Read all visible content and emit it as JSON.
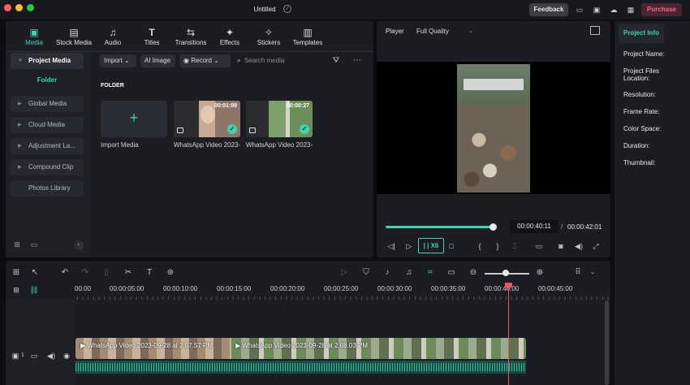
{
  "window": {
    "title": "Untitled",
    "feedback_label": "Feedback",
    "purchase_label": "Purchase",
    "traffic_colors": [
      "#fe5f57",
      "#febc2e",
      "#28c840"
    ]
  },
  "media_tabs": [
    {
      "label": "Media",
      "icon": "media-icon",
      "active": true
    },
    {
      "label": "Stock Media",
      "icon": "stock-media-icon"
    },
    {
      "label": "Audio",
      "icon": "music-note-icon"
    },
    {
      "label": "Titles",
      "icon": "text-t-icon"
    },
    {
      "label": "Transitions",
      "icon": "transitions-icon"
    },
    {
      "label": "Effects",
      "icon": "effects-sparkle-icon"
    },
    {
      "label": "Stickers",
      "icon": "stickers-icon"
    },
    {
      "label": "Templates",
      "icon": "templates-icon"
    }
  ],
  "sidebar": {
    "project_media": "Project Media",
    "folder": "Folder",
    "items": [
      "Global Media",
      "Cloud Media",
      "Adjustment La...",
      "Compound Clip",
      "Photos Library"
    ]
  },
  "media_toolbar": {
    "import": "Import",
    "ai_image": "AI Image",
    "record": "Record",
    "search_placeholder": "Search media"
  },
  "media_area": {
    "folder_heading": "FOLDER",
    "import_label": "Import Media",
    "clips": [
      {
        "label": "WhatsApp Video 2023-...",
        "duration": "00:01:09"
      },
      {
        "label": "WhatsApp Video 2023-...",
        "duration": "00:00:27"
      }
    ]
  },
  "player": {
    "label": "Player",
    "quality": "Full Quality",
    "current_time": "00:00:40:11",
    "separator": "/",
    "total_time": "00:00:42:01",
    "speed_label": "X6",
    "progress_percent": 0.96
  },
  "project_info": {
    "tab": "Project Info",
    "rows": [
      "Project Name:",
      "Project Files Location:",
      "Resolution:",
      "Frame Rate:",
      "Color Space:",
      "Duration:",
      "Thumbnail:"
    ]
  },
  "timeline": {
    "ruler_labels": [
      "00:00",
      "00:00:05:00",
      "00:00:10:00",
      "00:00:15:00",
      "00:00:20:00",
      "00:00:25:00",
      "00:00:30:00",
      "00:00:35:00",
      "00:00:40:00",
      "00:00:45:00"
    ],
    "clip1_title": "WhatsApp Video 2023-09-28 at 2.07.57 PM",
    "clip2_title": "WhatsApp Video 2023-09-28 at 2.08.03 PM",
    "track_number": "1",
    "accent": "#3fd3b0",
    "playhead_color": "#f25562"
  }
}
